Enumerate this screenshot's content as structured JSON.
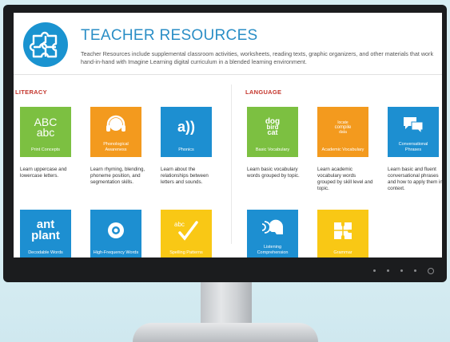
{
  "header": {
    "title": "TEACHER RESOURCES",
    "description": "Teacher Resources include supplemental classroom activities, worksheets, reading texts, graphic organizers, and other materials that work hand-in-hand with Imagine Learning digital curriculum in a blended learning environment."
  },
  "literacy": {
    "title": "LITERACY",
    "tiles": [
      {
        "glyph": "ABC\nabc",
        "label": "Print Concepts",
        "desc": "Learn uppercase and lowercase letters."
      },
      {
        "glyph": "",
        "label": "Phonological Awareness",
        "desc": "Learn rhyming, blending, phoneme position, and segmentation skills."
      },
      {
        "glyph": "a))",
        "label": "Phonics",
        "desc": "Learn about the relationships between letters and sounds."
      },
      {
        "glyph": "ant\nplant",
        "label": "Decodable Words",
        "desc": ""
      },
      {
        "glyph": "",
        "label": "High-Frequency Words",
        "desc": ""
      },
      {
        "glyph": "abc",
        "label": "Spelling Patterns",
        "desc": ""
      }
    ]
  },
  "language": {
    "title": "LANGUAGE",
    "tiles": [
      {
        "glyph": "dog\nbird\ncat",
        "label": "Basic Vocabulary",
        "desc": "Learn basic vocabulary words grouped by topic."
      },
      {
        "glyph": "locate\ncompile\ndata",
        "label": "Academic Vocabulary",
        "desc": "Learn academic vocabulary words grouped by skill level and topic."
      },
      {
        "glyph": "",
        "label": "Conversational Phrases",
        "desc": "Learn basic and fluent conversational phrases and how to apply them in context."
      },
      {
        "glyph": "",
        "label": "Listening Comprehension",
        "desc": ""
      },
      {
        "glyph": "",
        "label": "Grammar",
        "desc": ""
      }
    ]
  },
  "colors": {
    "green": "#7cc041",
    "orange": "#f39a1e",
    "blue": "#1d8fd1",
    "yellow": "#f9c815",
    "accent_red": "#c4352c",
    "title_blue": "#2a8ec6"
  },
  "icons": [
    "puzzle-logo-icon",
    "headphones-icon",
    "sound-icon",
    "eye-icon",
    "checkmark-icon",
    "speech-bubbles-icon",
    "speaking-head-icon",
    "puzzle-pieces-icon",
    "power-icon"
  ]
}
